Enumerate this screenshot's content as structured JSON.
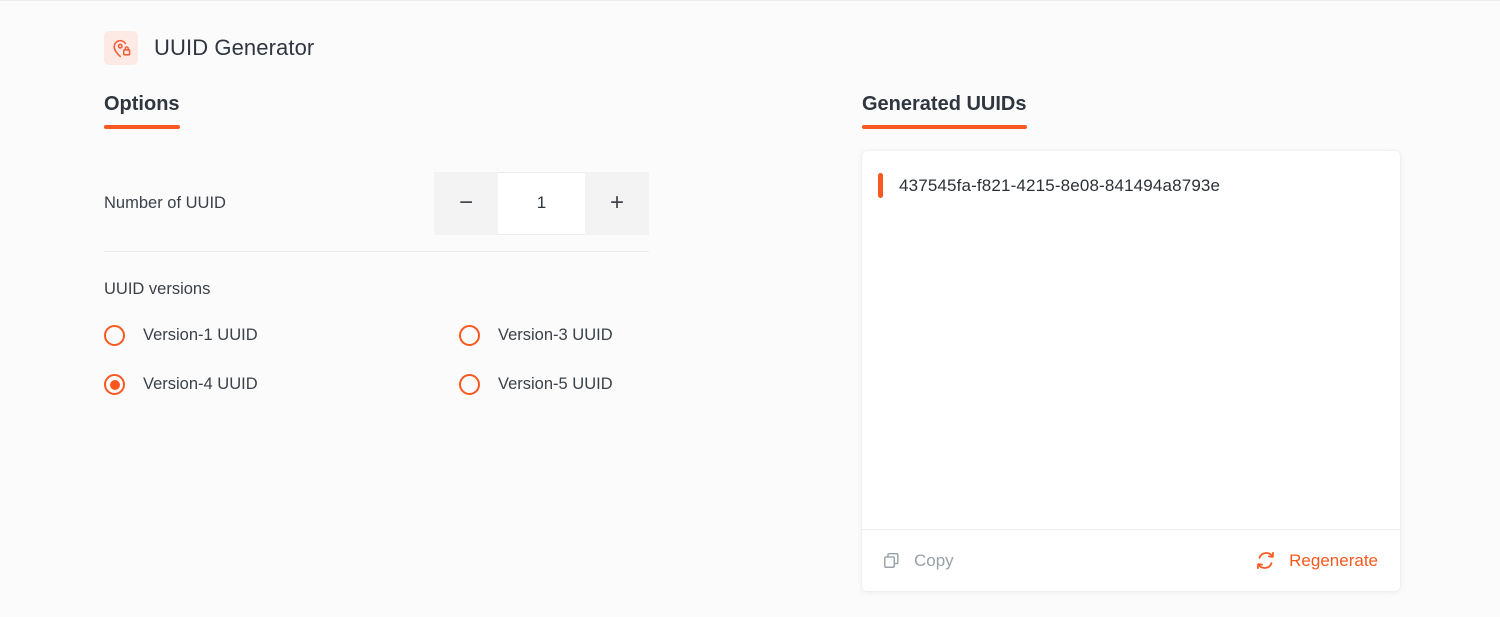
{
  "app": {
    "title": "UUID Generator",
    "icon": "location-pin-lock-icon",
    "accent_color": "#f9581f",
    "icon_bg_color": "#fdeae4",
    "background_color": "#fbfbfb"
  },
  "options": {
    "heading": "Options",
    "number_of_uuid": {
      "label": "Number of UUID",
      "value": "1",
      "decrement_label": "−",
      "increment_label": "+"
    },
    "versions": {
      "group_label": "UUID versions",
      "items": [
        {
          "label": "Version-1 UUID",
          "checked": false
        },
        {
          "label": "Version-3 UUID",
          "checked": false
        },
        {
          "label": "Version-4 UUID",
          "checked": true
        },
        {
          "label": "Version-5 UUID",
          "checked": false
        }
      ]
    }
  },
  "generated": {
    "heading": "Generated UUIDs",
    "uuids": [
      "437545fa-f821-4215-8e08-841494a8793e"
    ],
    "footer": {
      "copy_label": "Copy",
      "copy_icon": "copy-icon",
      "regenerate_label": "Regenerate",
      "regenerate_icon": "refresh-icon"
    }
  }
}
